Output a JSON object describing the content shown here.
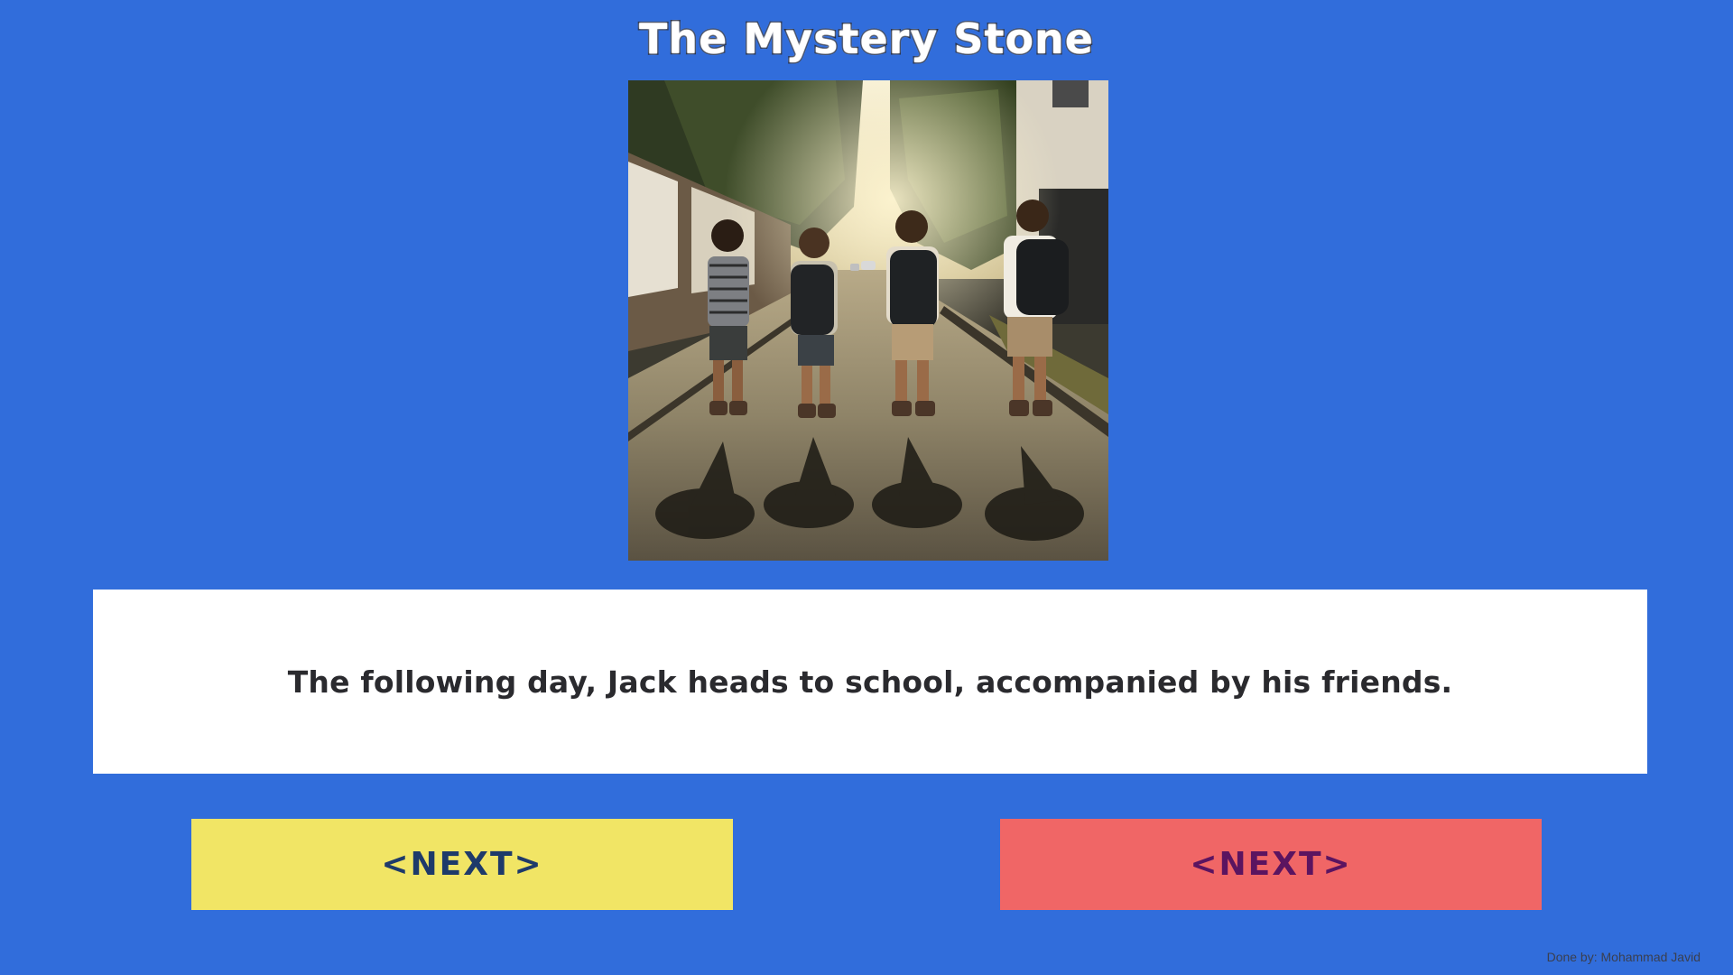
{
  "page": {
    "title": "The Mystery Stone",
    "background_color": "#316ddb"
  },
  "scene_image": {
    "alt": "Four boys with backpacks walking down a sunlit tree-lined street"
  },
  "story": {
    "text": "The following day, Jack heads to school, accompanied by his friends."
  },
  "buttons": {
    "left_label": "<NEXT>",
    "left_color": "#f1e565",
    "right_label": "<NEXT>",
    "right_color": "#f06666"
  },
  "footer": {
    "credit": "Done by: Mohammad Javid"
  }
}
